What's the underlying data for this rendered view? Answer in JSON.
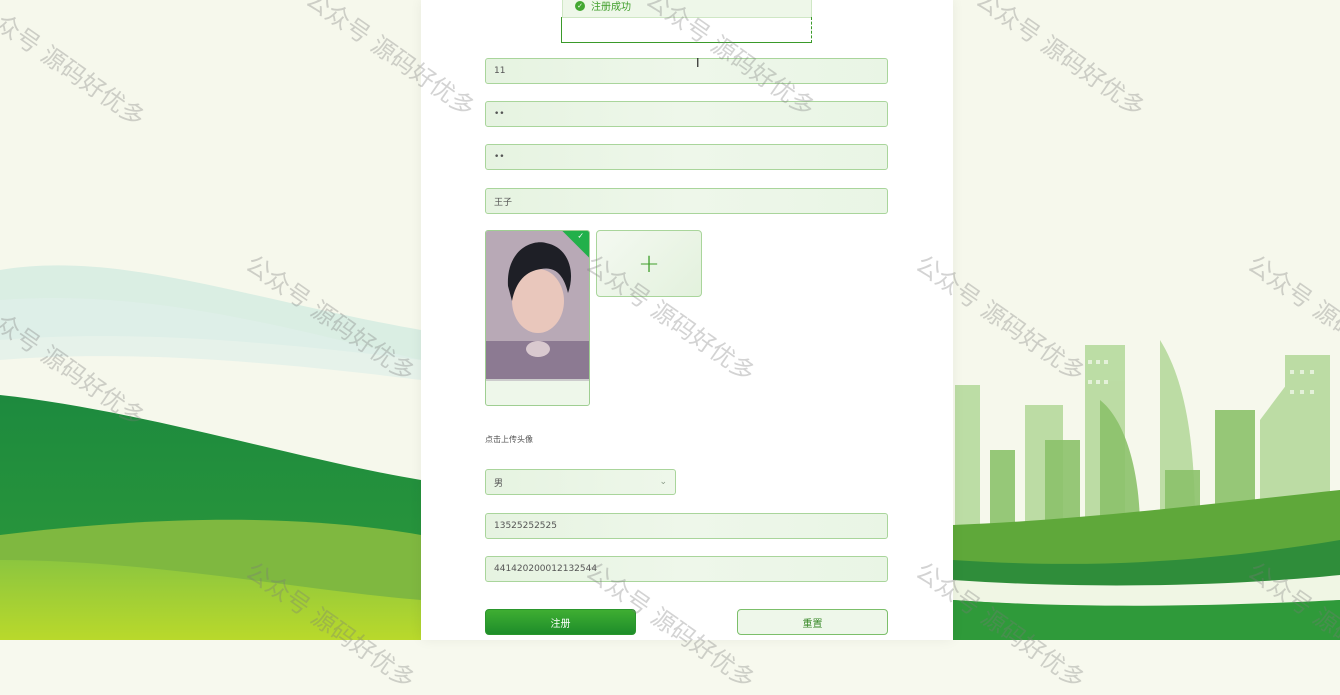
{
  "toast": {
    "text": "注册成功",
    "icon": "check-circle-icon",
    "color": "#44a832"
  },
  "form": {
    "account": "11",
    "password": "••",
    "confirm_password": "••",
    "name": "王子",
    "avatar_hint": "点击上传头像",
    "upload_icon": "plus-icon",
    "gender": "男",
    "phone": "13525252525",
    "id_number": "441420200012132544",
    "register_label": "注册",
    "reset_label": "重置"
  },
  "watermark": "公众号 源码好优多",
  "colors": {
    "primary": "#2a9a2c",
    "field_bg": "#e9f5e5",
    "field_border": "#a9d59b"
  }
}
